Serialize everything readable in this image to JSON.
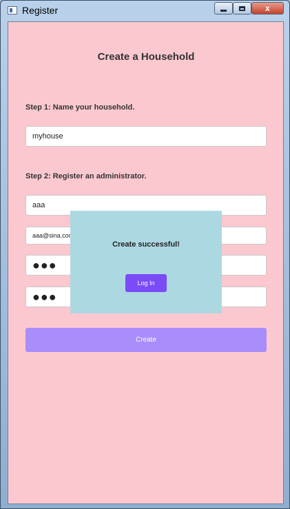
{
  "window": {
    "title": "Register",
    "controls": {
      "minimize_icon": "minimize-icon",
      "maximize_icon": "maximize-icon",
      "close_label": "x"
    }
  },
  "form": {
    "heading": "Create a Household",
    "step1_label": "Step 1: Name your household.",
    "household_name": "myhouse",
    "step2_label": "Step 2: Register an administrator.",
    "admin_name": "aaa",
    "admin_email": "aaa@sina.com",
    "password_mask": "●●●",
    "confirm_password_mask": "●●●",
    "create_label": "Create"
  },
  "dialog": {
    "message": "Create successful!",
    "login_label": "Log In"
  },
  "colors": {
    "background": "#fbc8cf",
    "create_button": "#a88dfb",
    "dialog": "#acd8e2",
    "login_button": "#7a4bf6"
  }
}
